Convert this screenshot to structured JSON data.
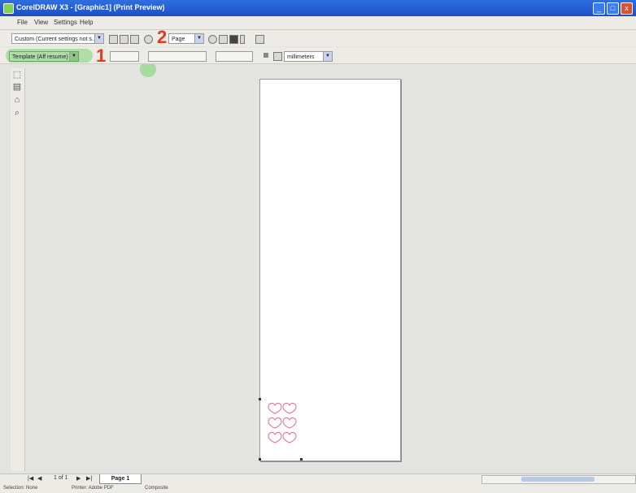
{
  "window": {
    "title": "CorelDRAW X3 - [Graphic1] (Print Preview)",
    "controls": [
      "_",
      "□",
      "x"
    ]
  },
  "menu": {
    "items": [
      "File",
      "View",
      "Settings",
      "Help"
    ]
  },
  "toolbar1": {
    "print_style": "Custom (Current settings not s...",
    "zoom": "Page"
  },
  "toolbar2": {
    "imposition": "Template (Aff resume)",
    "units": "millimeters"
  },
  "callouts": {
    "one": "1",
    "two": "2"
  },
  "highlight_color": "#a8dba0",
  "callout_color": "#e23a1e",
  "tools": [
    "pick-icon",
    "imposition-layout-icon",
    "marks-placement-icon",
    "zoom-icon"
  ],
  "page_nav": {
    "counter": "1 of 1",
    "tab": "Page 1"
  },
  "status": {
    "selection": "Selection: None",
    "printer": "Printer: Adobe PDF",
    "color": "Composite"
  }
}
